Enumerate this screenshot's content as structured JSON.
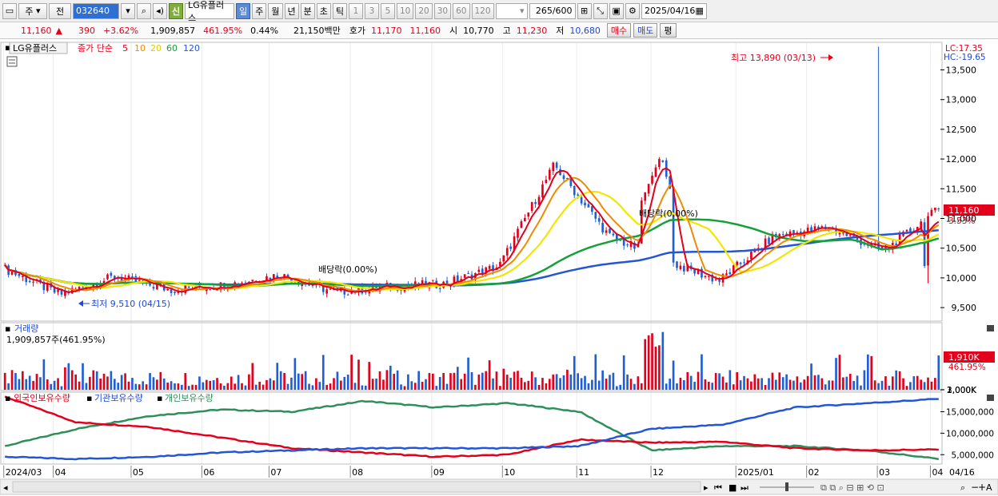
{
  "toolbar": {
    "market": "주",
    "prev": "전",
    "code": "032640",
    "name": "LG유플러스",
    "new_badge": "신",
    "periods": [
      "일",
      "주",
      "월",
      "년",
      "분",
      "초",
      "틱"
    ],
    "intervals": [
      "1",
      "3",
      "5",
      "10",
      "20",
      "30",
      "60",
      "120"
    ],
    "count": "265",
    "count_total": "/600",
    "date": "2025/04/16"
  },
  "quote": {
    "price": "11,160",
    "change": "390",
    "change_pct": "+3.62%",
    "volume": "1,909,857",
    "volume_ratio": "461.95%",
    "turnover": "0.44%",
    "amount": "21,150백만",
    "ask_label": "호가",
    "ask": "11,170",
    "bid": "11,160",
    "open_label": "시",
    "open": "10,770",
    "high_label": "고",
    "high": "11,230",
    "low_label": "저",
    "low": "10,680",
    "buy": "매수",
    "sell": "매도",
    "eval": "평"
  },
  "price_panel": {
    "stock_label": "LG유플러스",
    "series_label": "종가 단순",
    "ma_periods": [
      "5",
      "10",
      "20",
      "60",
      "120"
    ],
    "lc": "LC:17.35",
    "hc": "HC:-19.65",
    "high_note": "최고 13,890 (03/13)",
    "low_note": "최저 9,510 (04/15)",
    "dividend_note_1": "배당락(0.00%)",
    "dividend_note_2": "배당락(0.00%)",
    "last_price_tag": "11,160",
    "last_pct_tag": "3.53%",
    "y_ticks": [
      "13,500",
      "13,000",
      "12,500",
      "12,000",
      "11,500",
      "11,000",
      "10,500",
      "10,000",
      "9,500"
    ]
  },
  "volume_panel": {
    "title": "거래량",
    "value_label": "1,909,857주(461.95%)",
    "y_ticks": [
      "3,000K",
      "2,000K",
      "1,000K"
    ],
    "last_tag": "1,910K",
    "last_pct": "461.95%"
  },
  "holdings_panel": {
    "legend": [
      "외국인보유수량",
      "기관보유수량",
      "개인보유수량"
    ],
    "y_ticks": [
      "15,000,000",
      "10,000,000",
      "5,000,000"
    ]
  },
  "x_axis": [
    "2024/03",
    "04",
    "05",
    "06",
    "07",
    "08",
    "09",
    "10",
    "11",
    "12",
    "2025/01",
    "02",
    "03",
    "04"
  ],
  "x_axis_end": "04/16",
  "colors": {
    "up": "#e3001b",
    "down": "#1f5fd6",
    "ma5": "#e3001b",
    "ma10": "#f08a00",
    "ma20": "#f2e600",
    "ma60": "#15a03a",
    "ma120": "#2255d8",
    "foreign": "#e3001b",
    "institution": "#2255d8",
    "individual": "#2e8f5a"
  },
  "chart_data": {
    "type": "candlestick",
    "y_range": [
      9300,
      13950
    ],
    "monthly_close_path": [
      10150,
      9720,
      10020,
      9800,
      9880,
      10050,
      9760,
      9850,
      9900,
      10200,
      11900,
      10700,
      10300,
      9950,
      10700,
      10850,
      10450,
      11160
    ],
    "last_close": 11160,
    "high": {
      "value": 13890,
      "date": "03/13"
    },
    "low": {
      "value": 9510,
      "date": "04/15"
    }
  }
}
